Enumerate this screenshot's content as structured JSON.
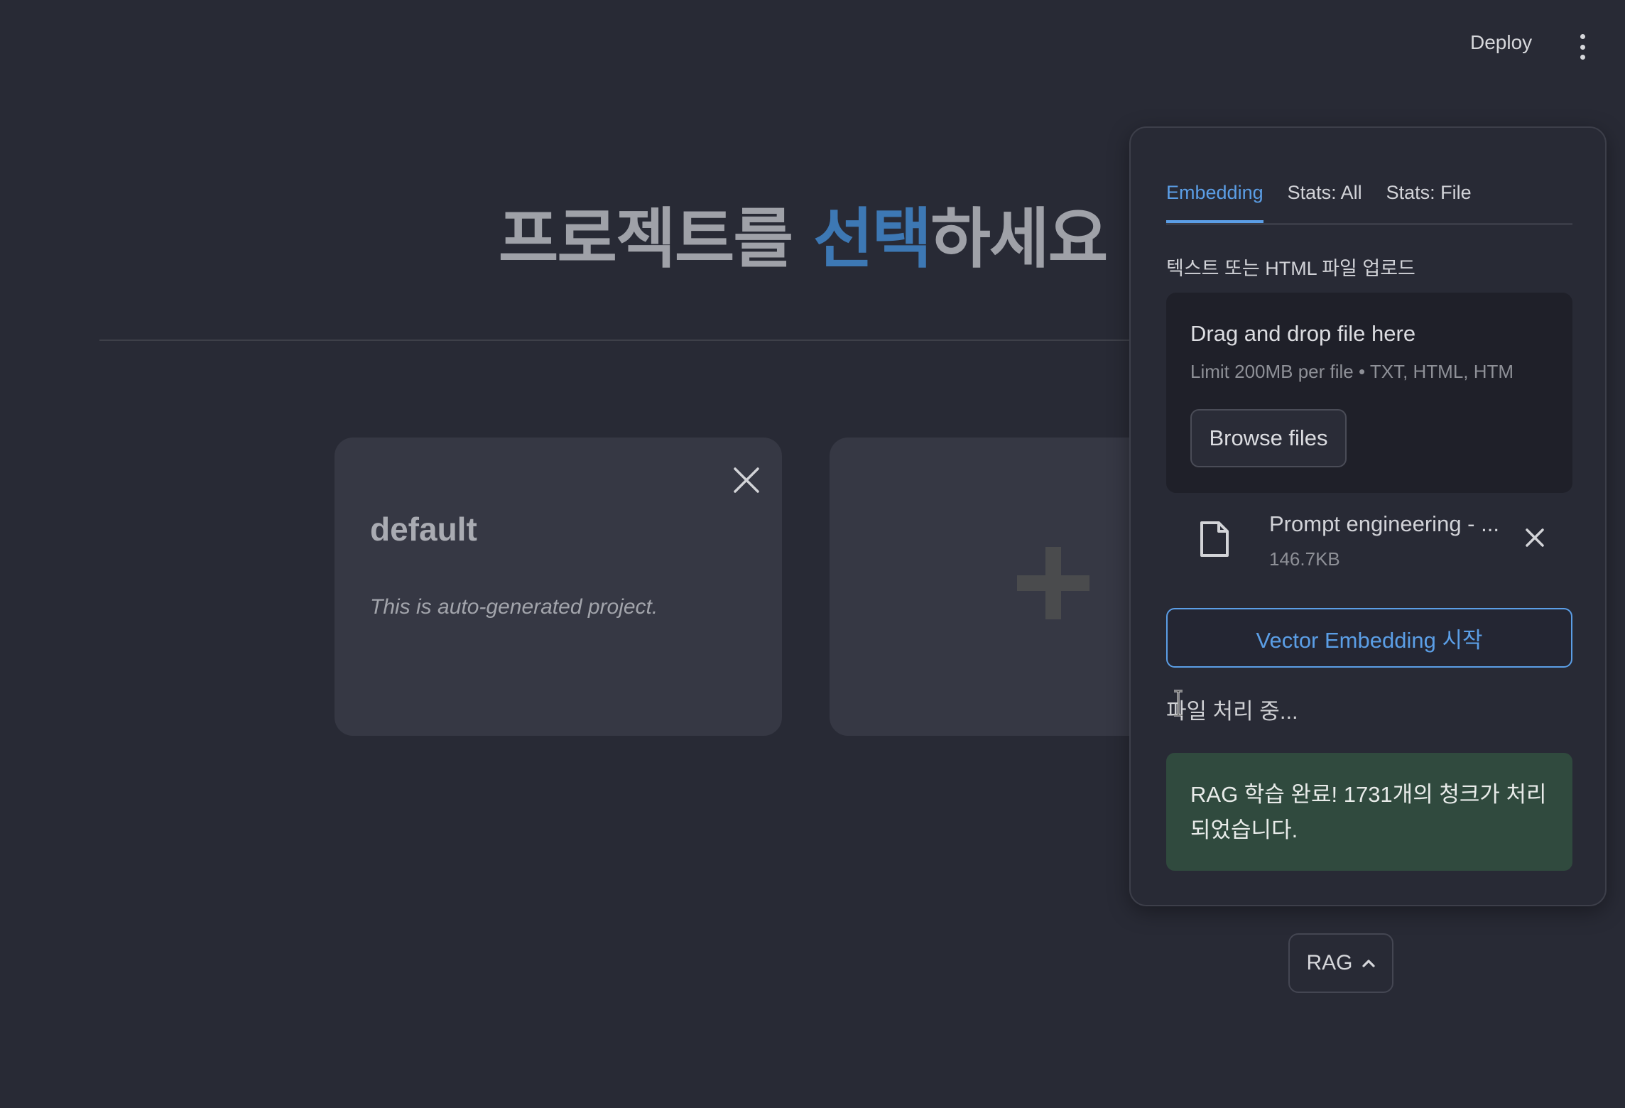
{
  "header": {
    "deploy_label": "Deploy",
    "menu_icon": "kebab-menu-icon"
  },
  "page": {
    "title_before": "프로젝트를 ",
    "title_highlight": "선택",
    "title_after": "하세요",
    "highlight_color": "#3d78b4"
  },
  "projects": [
    {
      "name": "default",
      "description": "This is auto-generated project.",
      "close_icon": "close-icon"
    }
  ],
  "add_project": {
    "icon": "plus-icon"
  },
  "rag_panel": {
    "tabs": [
      {
        "label": "Embedding",
        "active": true
      },
      {
        "label": "Stats: All",
        "active": false
      },
      {
        "label": "Stats: File",
        "active": false
      }
    ],
    "upload_label": "텍스트 또는 HTML 파일 업로드",
    "dropzone": {
      "title": "Drag and drop file here",
      "limit": "Limit 200MB per file • TXT, HTML, HTM",
      "browse_label": "Browse files"
    },
    "file": {
      "name": "Prompt engineering - ...",
      "size": "146.7KB",
      "icon": "file-icon"
    },
    "embed_button_label": "Vector Embedding 시작",
    "processing_text": "파일 처리 중...",
    "success_message": "RAG 학습 완료! 1731개의 청크가 처리되었습니다."
  },
  "rag_toggle": {
    "label": "RAG",
    "icon": "chevron-up-icon"
  },
  "colors": {
    "accent": "#5b9ee6",
    "success_bg": "#304a3e",
    "background": "#282a35"
  }
}
